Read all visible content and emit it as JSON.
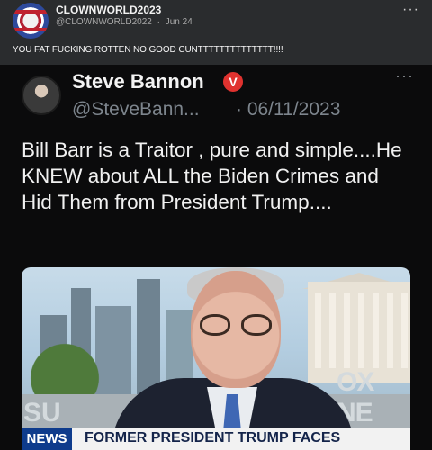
{
  "post": {
    "author_name": "CLOWNWORLD2023",
    "author_handle": "@CLOWNWORLD2022",
    "separator": "·",
    "date": "Jun 24",
    "more": "···",
    "text": "YOU FAT FUCKING ROTTEN NO GOOD CUNTTTTTTTTTTTTTT!!!!"
  },
  "embedded_tweet": {
    "author_name": "Steve Bannon",
    "verified_mark": "V",
    "handle": "@SteveBann...",
    "date": "· 06/11/2023",
    "more": "···",
    "body": "Bill Barr is a Traitor , pure and simple....He KNEW about ALL the Biden Crimes and Hid Them from President Trump....",
    "image": {
      "network_logo": "NEWS",
      "chyron": "FORMER PRESIDENT TRUMP FACES",
      "background_left_text": "SU",
      "background_right_text": "OX NE"
    }
  }
}
